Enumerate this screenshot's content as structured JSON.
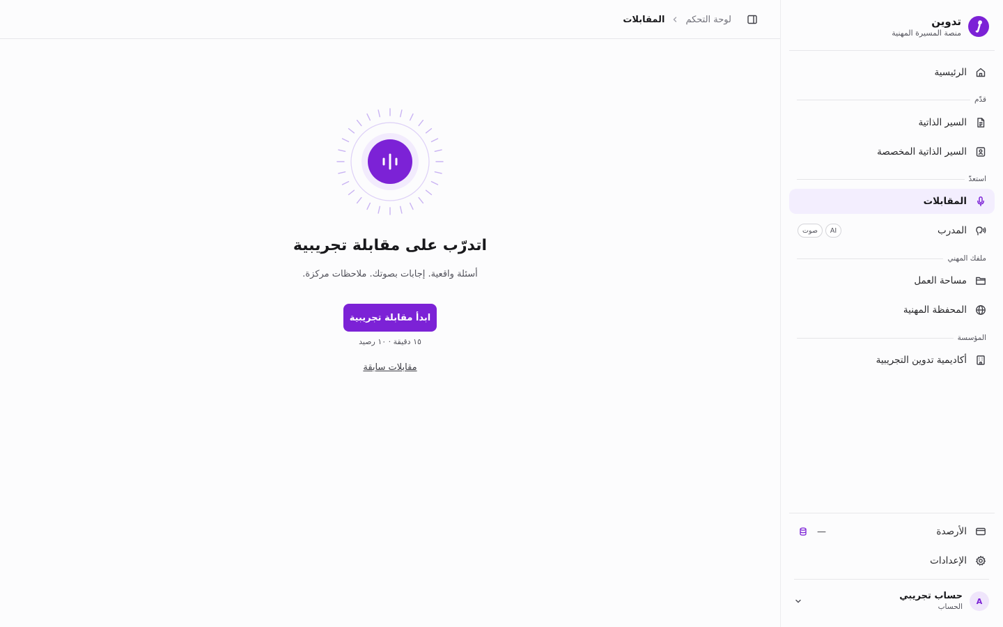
{
  "brand": {
    "name": "تدوين",
    "subtitle": "منصة المسيرة المهنية",
    "logo_icon": "brand-logo-icon"
  },
  "breadcrumb": {
    "parent": "لوحة التحكم",
    "current": "المقابلات"
  },
  "sidebar": {
    "home": "الرئيسية",
    "sections": {
      "apply": "قدّم",
      "prepare": "استعدّ",
      "profile": "ملفك المهني",
      "institution": "المؤسسة"
    },
    "items": {
      "resumes": "السير الذاتية",
      "custom_resumes": "السير الذاتية المخصصة",
      "interviews": "المقابلات",
      "coach": "المدرب",
      "coach_badge_ai": "AI",
      "coach_badge_voice": "صوت",
      "workspace": "مساحة العمل",
      "portfolio": "المحفظة المهنية",
      "academy": "أكاديمية تدوين التجريبية",
      "credits": "الأرصدة",
      "credits_value": "—",
      "settings": "الإعدادات"
    },
    "account": {
      "initial": "A",
      "name": "حساب تجريبي",
      "label": "الحساب"
    }
  },
  "main": {
    "title": "اتدرّب على مقابلة تجريبية",
    "subtitle": "أسئلة واقعية. إجابات بصوتك. ملاحظات مركزة.",
    "cta_label": "ابدأ مقابلة تجريبية",
    "cta_meta": "١٥ دقيقة · ١٠ رصيد",
    "past_link": "مقابلات سابقة"
  },
  "colors": {
    "accent": "#7c22d6",
    "active_bg": "#f3eefe",
    "border": "#e7e7ea"
  }
}
